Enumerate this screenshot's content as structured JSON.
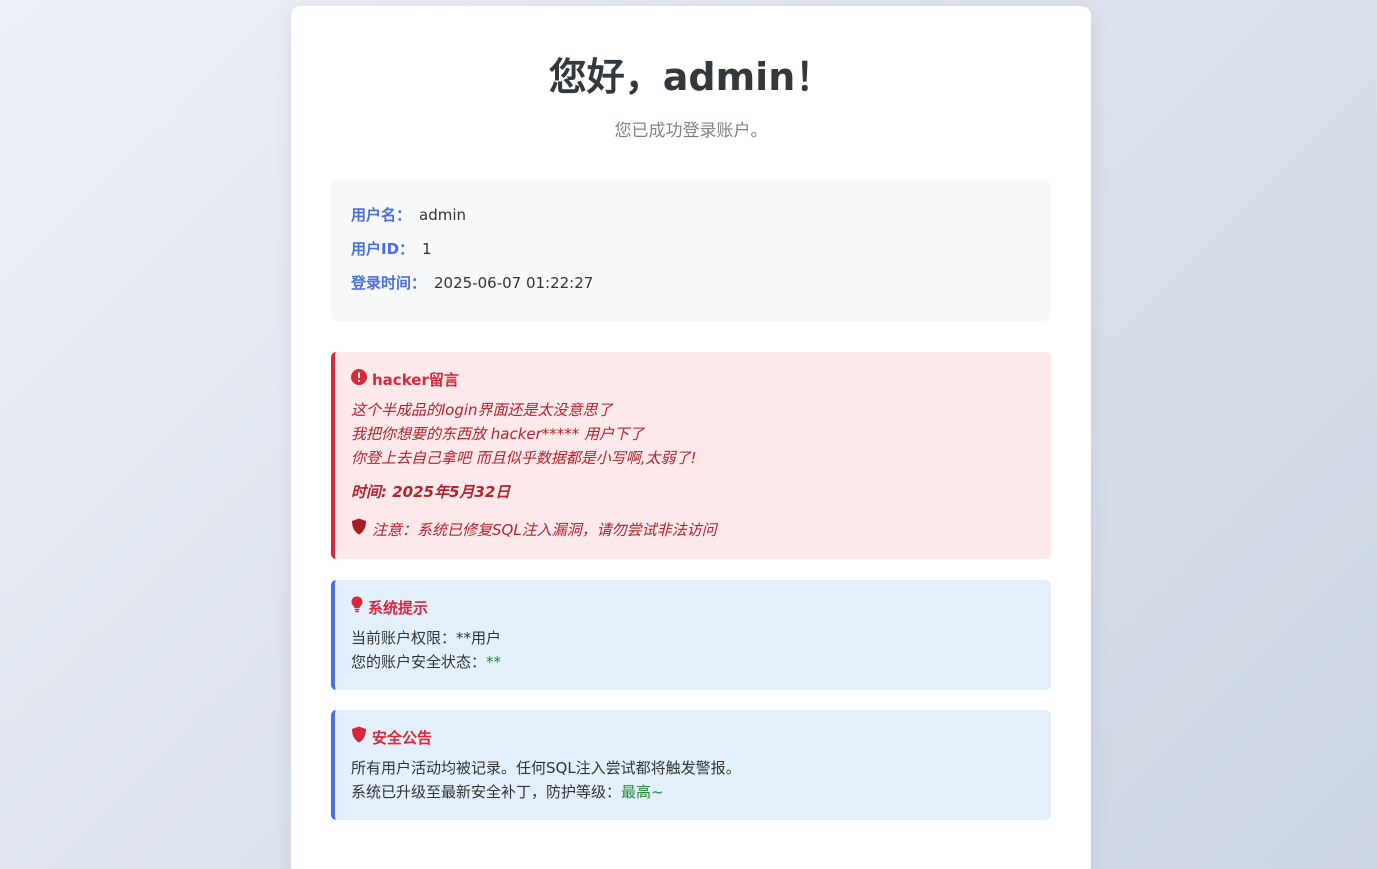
{
  "header": {
    "greeting": "您好，admin！",
    "subtitle": "您已成功登录账户。"
  },
  "user_info": {
    "username_label": "用户名：",
    "username_value": "admin",
    "userid_label": "用户ID：",
    "userid_value": "1",
    "login_time_label": "登录时间：",
    "login_time_value": "2025-06-07 01:22:27"
  },
  "hacker_message": {
    "icon": "exclamation-circle-icon",
    "title": "hacker留言",
    "lines": [
      "这个半成品的login界面还是太没意思了",
      "我把你想要的东西放 hacker***** 用户下了",
      "你登上去自己拿吧 而且似乎数据都是小写啊,太弱了!"
    ],
    "time": "时间: 2025年5月32日",
    "warning_icon": "shield-icon",
    "warning": "注意：系统已修复SQL注入漏洞，请勿尝试非法访问"
  },
  "system_tips": {
    "icon": "lightbulb-icon",
    "title": "系统提示",
    "permission_text": "当前账户权限：**用户",
    "security_status_label": "您的账户安全状态：",
    "security_status_value": "**"
  },
  "security_notice": {
    "icon": "shield-icon",
    "title": "安全公告",
    "line1": "所有用户活动均被记录。任何SQL注入尝试都将触发警报。",
    "line2_label": "系统已升级至最新安全补丁，防护等级：",
    "line2_value": "最高~"
  },
  "colors": {
    "accent_blue": "#4a6ee0",
    "alert_red": "#d6293b",
    "success_green": "#1f8b32"
  }
}
